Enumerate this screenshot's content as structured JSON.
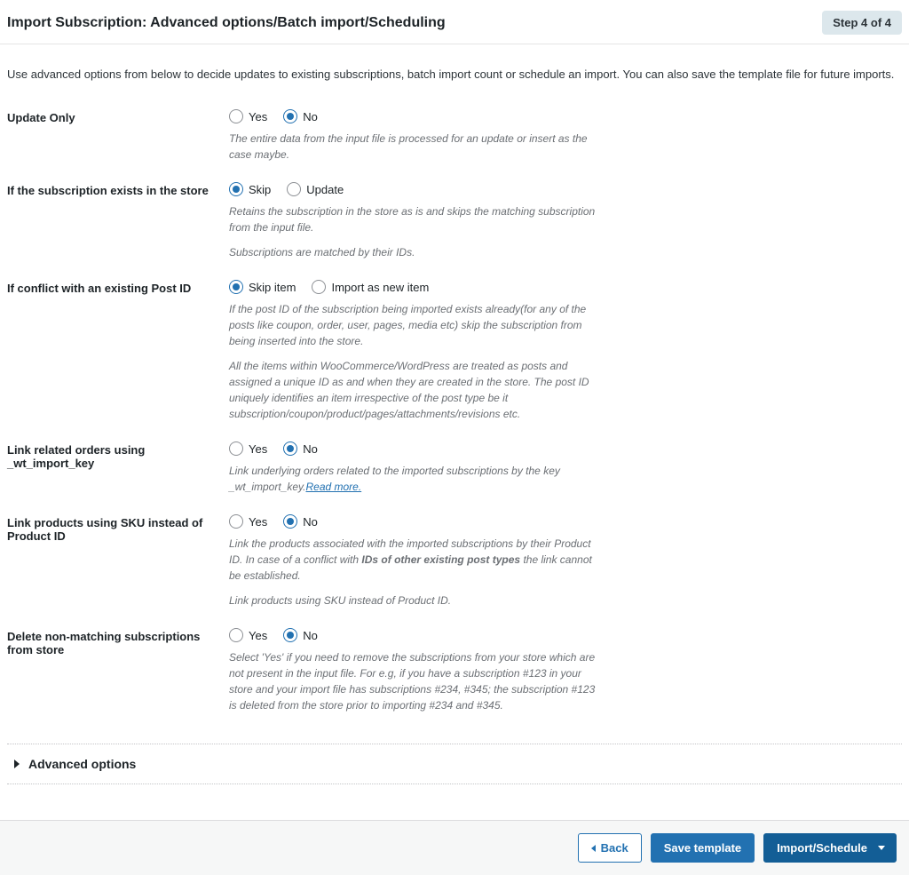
{
  "header": {
    "title": "Import Subscription: Advanced options/Batch import/Scheduling",
    "step_badge": "Step 4 of 4"
  },
  "intro": "Use advanced options from below to decide updates to existing subscriptions, batch import count or schedule an import. You can also save the template file for future imports.",
  "common": {
    "yes": "Yes",
    "no": "No"
  },
  "fields": {
    "update_only": {
      "label": "Update Only",
      "selected": "No",
      "help": "The entire data from the input file is processed for an update or insert as the case maybe."
    },
    "if_exists": {
      "label": "If the subscription exists in the store",
      "opt_skip": "Skip",
      "opt_update": "Update",
      "selected": "Skip",
      "help1": "Retains the subscription in the store as is and skips the matching subscription from the input file.",
      "help2": "Subscriptions are matched by their IDs."
    },
    "conflict": {
      "label": "If conflict with an existing Post ID",
      "opt_skip": "Skip item",
      "opt_import": "Import as new item",
      "selected": "Skip item",
      "help1": "If the post ID of the subscription being imported exists already(for any of the posts like coupon, order, user, pages, media etc) skip the subscription from being inserted into the store.",
      "help2": "All the items within WooCommerce/WordPress are treated as posts and assigned a unique ID as and when they are created in the store. The post ID uniquely identifies an item irrespective of the post type be it subscription/coupon/product/pages/attachments/revisions etc."
    },
    "link_orders": {
      "label": "Link related orders using _wt_import_key",
      "selected": "No",
      "help_prefix": "Link underlying orders related to the imported subscriptions by the key _wt_import_key.",
      "read_more": "Read more."
    },
    "link_sku": {
      "label": "Link products using SKU instead of Product ID",
      "selected": "No",
      "help1_pre": "Link the products associated with the imported subscriptions by their Product ID. In case of a conflict with ",
      "help1_bold": "IDs of other existing post types",
      "help1_post": " the link cannot be established.",
      "help2": "Link products using SKU instead of Product ID."
    },
    "delete_nonmatch": {
      "label": "Delete non-matching subscriptions from store",
      "selected": "No",
      "help": "Select 'Yes' if you need to remove the subscriptions from your store which are not present in the input file. For e.g, if you have a subscription #123 in your store and your import file has subscriptions #234, #345; the subscription #123 is deleted from the store prior to importing #234 and #345."
    }
  },
  "accordion": {
    "advanced": "Advanced options"
  },
  "footer": {
    "back": "Back",
    "save_template": "Save template",
    "import_schedule": "Import/Schedule"
  }
}
